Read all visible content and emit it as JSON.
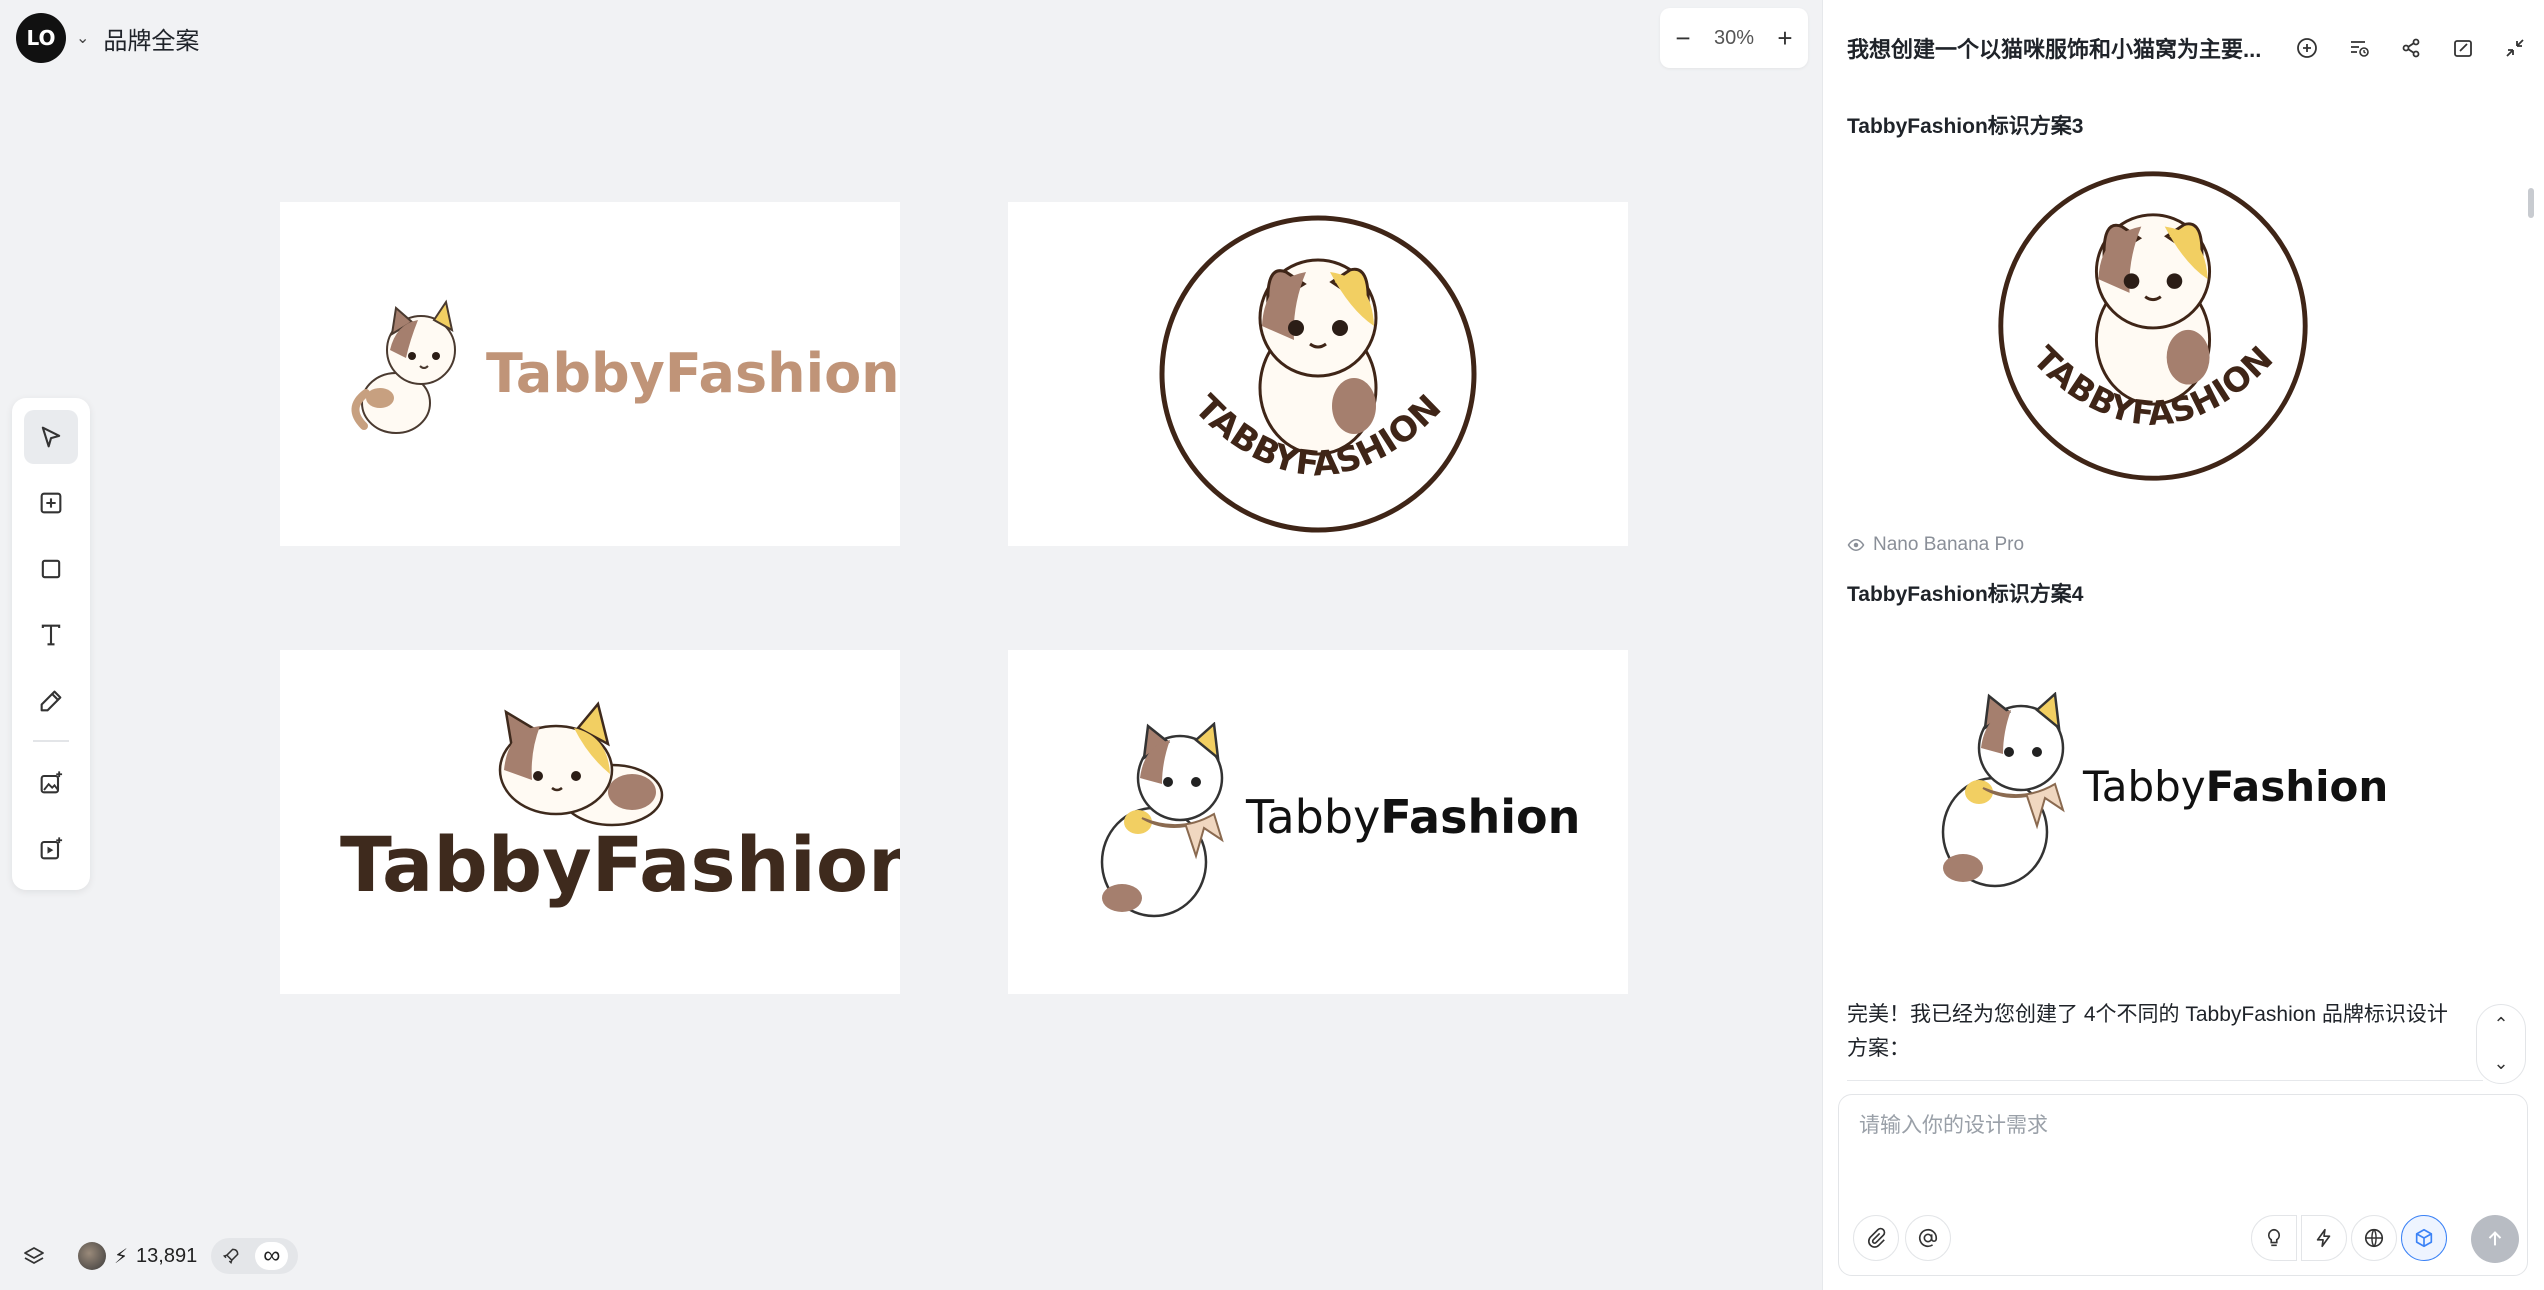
{
  "app": {
    "logo_text": "LO",
    "project_title": "品牌全案"
  },
  "zoom": {
    "minus": "−",
    "value": "30%",
    "plus": "+"
  },
  "cards": [
    {
      "brand": "TabbyFashion",
      "color": "#c09478"
    },
    {
      "brand": "TABBYFASHION",
      "color": "#3f2517"
    },
    {
      "brand": "TabbyFashion",
      "color": "#3e2a1d"
    },
    {
      "brand_light": "Tabby",
      "brand_bold": "Fashion",
      "color": "#111111"
    }
  ],
  "bottom": {
    "credits": "13,891",
    "infinity": "∞"
  },
  "panel": {
    "chat_title": "我想创建一个以猫咪服饰和小猫窝为主要...",
    "section3_title": "TabbyFashion标识方案3",
    "section3_ring_text": "TABBYFASHION",
    "model_name": "Nano Banana Pro",
    "section4_title": "TabbyFashion标识方案4",
    "section4_brand_light": "Tabby",
    "section4_brand_bold": "Fashion",
    "message": "完美！我已经为您创建了 4个不同的 TabbyFashion 品牌标识设计方案：",
    "input_placeholder": "请输入你的设计需求",
    "scroll_up": "⌃",
    "scroll_down": "⌄"
  },
  "colors": {
    "accent_blue": "#3b82f6",
    "cat_brown": "#a57f6e",
    "cat_yellow": "#f2cf62",
    "ring_brown": "#3f2517"
  }
}
